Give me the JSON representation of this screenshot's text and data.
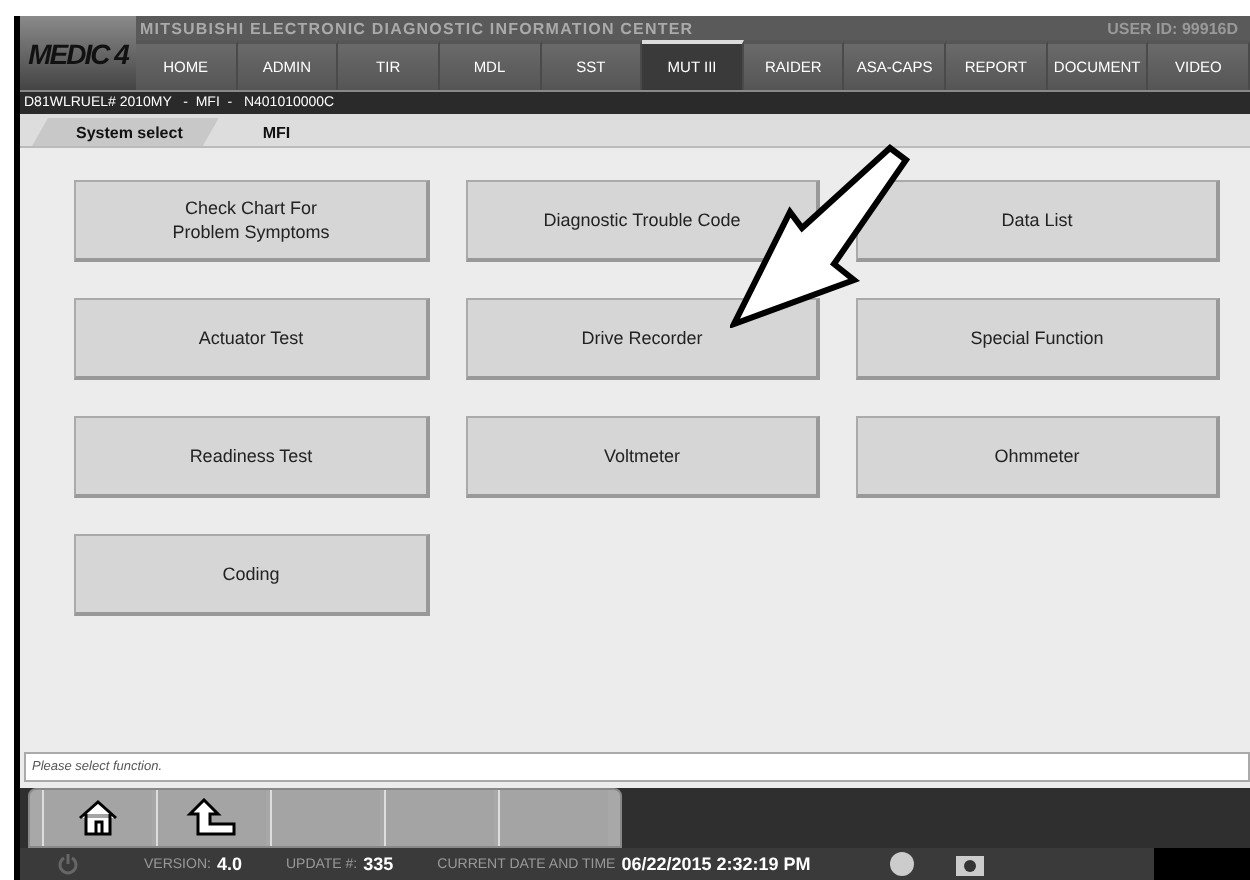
{
  "header": {
    "logo": "MEDIC 4",
    "title": "MITSUBISHI ELECTRONIC DIAGNOSTIC INFORMATION CENTER",
    "user_label": "USER ID:",
    "user_id": "99916D"
  },
  "nav": [
    {
      "label": "HOME",
      "selected": false
    },
    {
      "label": "ADMIN",
      "selected": false
    },
    {
      "label": "TIR",
      "selected": false
    },
    {
      "label": "MDL",
      "selected": false
    },
    {
      "label": "SST",
      "selected": false
    },
    {
      "label": "MUT III",
      "selected": true
    },
    {
      "label": "RAIDER",
      "selected": false
    },
    {
      "label": "ASA-CAPS",
      "selected": false
    },
    {
      "label": "REPORT",
      "selected": false
    },
    {
      "label": "DOCUMENT",
      "selected": false
    },
    {
      "label": "VIDEO",
      "selected": false
    }
  ],
  "breadcrumb": "D81WLRUEL# 2010MY   -  MFI  -   N401010000C",
  "tabs": [
    {
      "label": "System select",
      "selected": false
    },
    {
      "label": "MFI",
      "selected": true
    }
  ],
  "functions": [
    {
      "label": "Check Chart For\nProblem Symptoms"
    },
    {
      "label": "Diagnostic Trouble Code"
    },
    {
      "label": "Data List"
    },
    {
      "label": "Actuator Test"
    },
    {
      "label": "Drive Recorder"
    },
    {
      "label": "Special Function"
    },
    {
      "label": "Readiness Test"
    },
    {
      "label": "Voltmeter"
    },
    {
      "label": "Ohmmeter"
    },
    {
      "label": "Coding"
    }
  ],
  "status_message": "Please select function.",
  "footer": {
    "version_label": "VERSION:",
    "version": "4.0",
    "update_label": "UPDATE #:",
    "update": "335",
    "datetime_label": "CURRENT DATE AND TIME",
    "datetime": "06/22/2015 2:32:19 PM"
  }
}
